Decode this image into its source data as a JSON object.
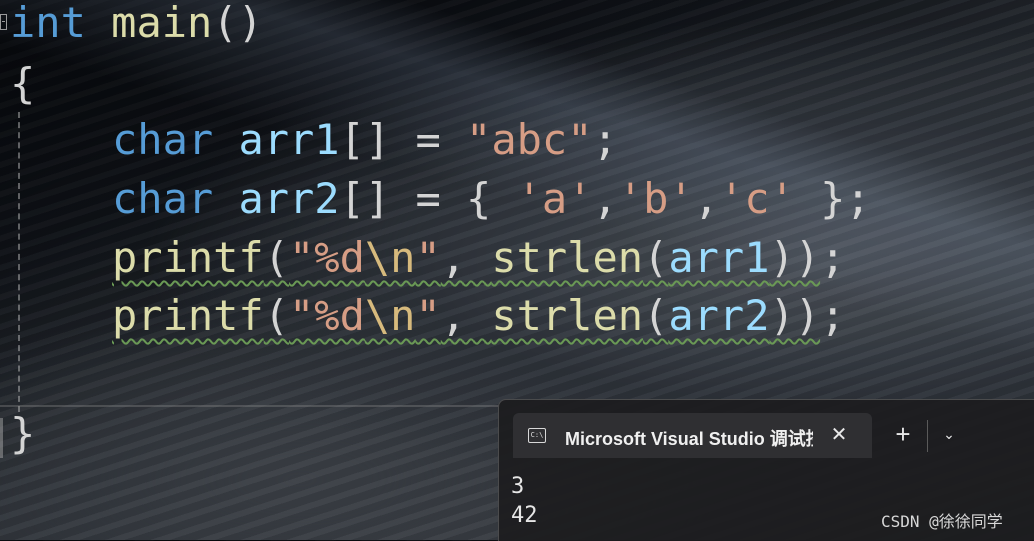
{
  "editor": {
    "line1": {
      "kw": "int",
      "fn": "main",
      "parens": "()"
    },
    "line2": {
      "brace": "{"
    },
    "line3": {
      "kw": "char",
      "var": "arr1",
      "brackets": "[]",
      "eq": " = ",
      "str": "\"abc\"",
      "semi": ";"
    },
    "line4": {
      "kw": "char",
      "var": "arr2",
      "brackets": "[]",
      "eq": " = ",
      "open": "{ ",
      "a": "'a'",
      "c1": ",",
      "b": "'b'",
      "c2": ",",
      "c": "'c'",
      "close": " };"
    },
    "line5": {
      "fn": "printf",
      "lp": "(",
      "q1": "\"%d",
      "esc": "\\n",
      "q2": "\"",
      "comma": ", ",
      "fn2": "strlen",
      "lp2": "(",
      "var": "arr1",
      "rp": "))",
      "semi": ";"
    },
    "line6": {
      "fn": "printf",
      "lp": "(",
      "q1": "\"%d",
      "esc": "\\n",
      "q2": "\"",
      "comma": ", ",
      "fn2": "strlen",
      "lp2": "(",
      "var": "arr2",
      "rp": "))",
      "semi": ";"
    },
    "line7": {
      "brace": "}"
    }
  },
  "terminal": {
    "tab_icon": "C:\\",
    "tab_title": "Microsoft Visual Studio 调试控制台",
    "close_glyph": "✕",
    "new_tab_glyph": "+",
    "dropdown_glyph": "⌄",
    "output": [
      "3",
      "42"
    ]
  },
  "watermark": "CSDN @徐徐同学",
  "colors": {
    "keyword": "#569cd6",
    "function": "#dcdcaa",
    "variable": "#9cdcfe",
    "string": "#d69d85",
    "escape": "#d7ba7d",
    "squiggle": "#6a9955"
  },
  "icons": {
    "tab_icon": "terminal-icon",
    "close": "close-icon",
    "new_tab": "plus-icon",
    "dropdown": "chevron-down-icon"
  }
}
